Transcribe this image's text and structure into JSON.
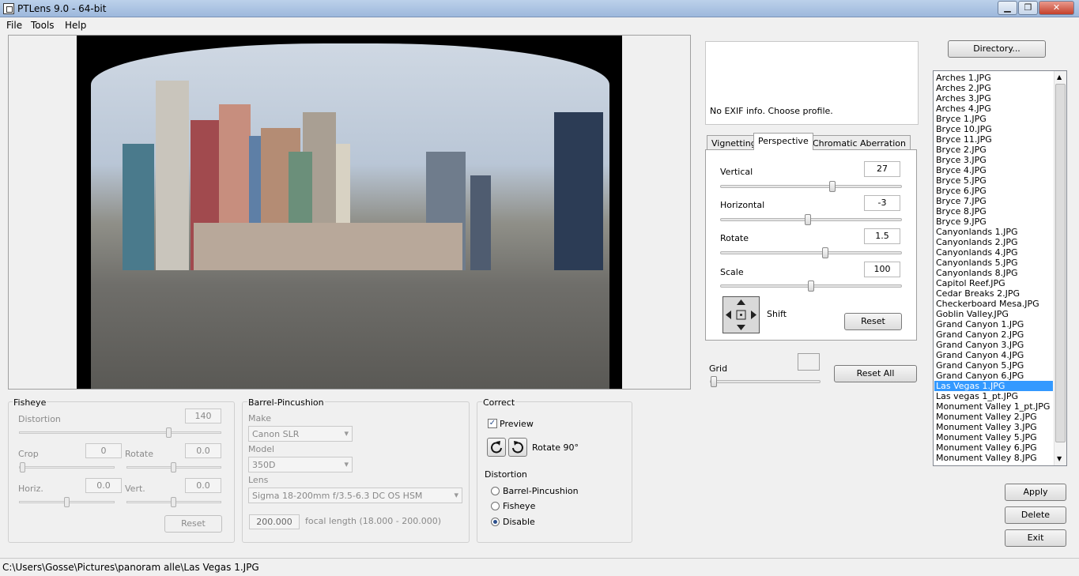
{
  "window": {
    "title": "PTLens 9.0 - 64-bit",
    "minimize": "▁",
    "maximize": "❐",
    "close": "✕"
  },
  "menu": [
    "File",
    "Tools",
    "Help"
  ],
  "exif": {
    "text": "No EXIF info. Choose profile."
  },
  "tabs": [
    "Vignetting",
    "Perspective",
    "Chromatic Aberration"
  ],
  "perspective": {
    "vertical": {
      "label": "Vertical",
      "value": "27",
      "level": 0.62
    },
    "horizontal": {
      "label": "Horizontal",
      "value": "-3",
      "level": 0.48
    },
    "rotate": {
      "label": "Rotate",
      "value": "1.5",
      "level": 0.58
    },
    "scale": {
      "label": "Scale",
      "value": "100",
      "level": 0.5
    },
    "shift_label": "Shift",
    "reset": "Reset"
  },
  "grid": {
    "label": "Grid",
    "reset_all": "Reset All"
  },
  "directory_button": "Directory...",
  "files": [
    "Arches 1.JPG",
    "Arches 2.JPG",
    "Arches 3.JPG",
    "Arches 4.JPG",
    "Bryce 1.JPG",
    "Bryce 10.JPG",
    "Bryce 11.JPG",
    "Bryce 2.JPG",
    "Bryce 3.JPG",
    "Bryce 4.JPG",
    "Bryce 5.JPG",
    "Bryce 6.JPG",
    "Bryce 7.JPG",
    "Bryce 8.JPG",
    "Bryce 9.JPG",
    "Canyonlands 1.JPG",
    "Canyonlands 2.JPG",
    "Canyonlands 4.JPG",
    "Canyonlands 5.JPG",
    "Canyonlands 8.JPG",
    "Capitol Reef.JPG",
    "Cedar Breaks 2.JPG",
    "Checkerboard Mesa.JPG",
    "Goblin Valley.JPG",
    "Grand Canyon 1.JPG",
    "Grand Canyon 2.JPG",
    "Grand Canyon 3.JPG",
    "Grand Canyon 4.JPG",
    "Grand Canyon 5.JPG",
    "Grand Canyon 6.JPG",
    "Las Vegas 1.JPG",
    "Las vegas 1_pt.JPG",
    "Monument Valley 1_pt.JPG",
    "Monument Valley 2.JPG",
    "Monument Valley 3.JPG",
    "Monument Valley 5.JPG",
    "Monument Valley 6.JPG",
    "Monument Valley 8.JPG"
  ],
  "selected_file": "Las Vegas 1.JPG",
  "actions": {
    "apply": "Apply",
    "delete": "Delete",
    "exit": "Exit"
  },
  "fisheye": {
    "title": "Fisheye",
    "distortion_label": "Distortion",
    "distortion": "140",
    "crop_label": "Crop",
    "crop": "0",
    "rotate_label": "Rotate",
    "rotate": "0.0",
    "horiz_label": "Horiz.",
    "horiz": "0.0",
    "vert_label": "Vert.",
    "vert": "0.0",
    "reset": "Reset"
  },
  "barrel": {
    "title": "Barrel-Pincushion",
    "make_label": "Make",
    "make": "Canon SLR",
    "model_label": "Model",
    "model": "350D",
    "lens_label": "Lens",
    "lens": "Sigma 18-200mm f/3.5-6.3 DC OS HSM",
    "focal": "200.000",
    "focal_label": "focal length (18.000 - 200.000)"
  },
  "correct": {
    "title": "Correct",
    "preview_label": "Preview",
    "preview_checked": true,
    "rotate_label": "Rotate 90°",
    "distortion_title": "Distortion",
    "options": [
      "Barrel-Pincushion",
      "Fisheye",
      "Disable"
    ],
    "selected": "Disable"
  },
  "status": {
    "path": "C:\\Users\\Gosse\\Pictures\\panoram alle\\Las Vegas 1.JPG"
  },
  "colors": {
    "selection": "#3399ff",
    "title_gradient": "#bcd1ea"
  }
}
